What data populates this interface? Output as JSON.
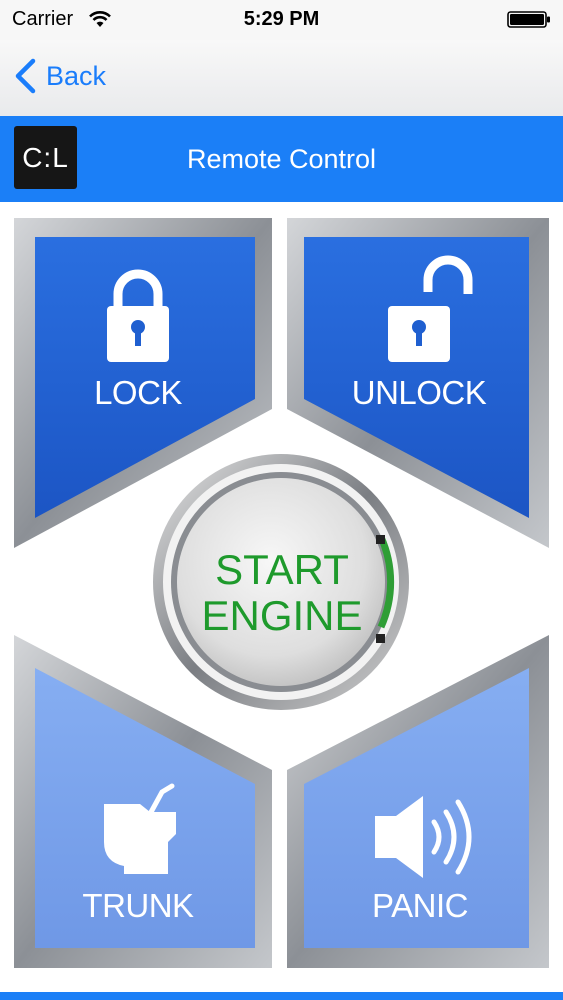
{
  "status_bar": {
    "carrier": "Carrier",
    "time": "5:29 PM"
  },
  "nav": {
    "back_label": "Back"
  },
  "header": {
    "logo_text": "C:L",
    "title": "Remote Control"
  },
  "controls": {
    "lock": {
      "label": "LOCK",
      "icon": "lock-icon"
    },
    "unlock": {
      "label": "UNLOCK",
      "icon": "unlock-icon"
    },
    "start": {
      "label_line1": "START",
      "label_line2": "ENGINE"
    },
    "trunk": {
      "label": "TRUNK",
      "icon": "trunk-icon"
    },
    "panic": {
      "label": "PANIC",
      "icon": "speaker-icon"
    }
  },
  "colors": {
    "accent": "#1b7ff7",
    "active_button": "#1f62d4",
    "inactive_button": "#7fa8ef",
    "engine_text": "#1e9a2c"
  }
}
